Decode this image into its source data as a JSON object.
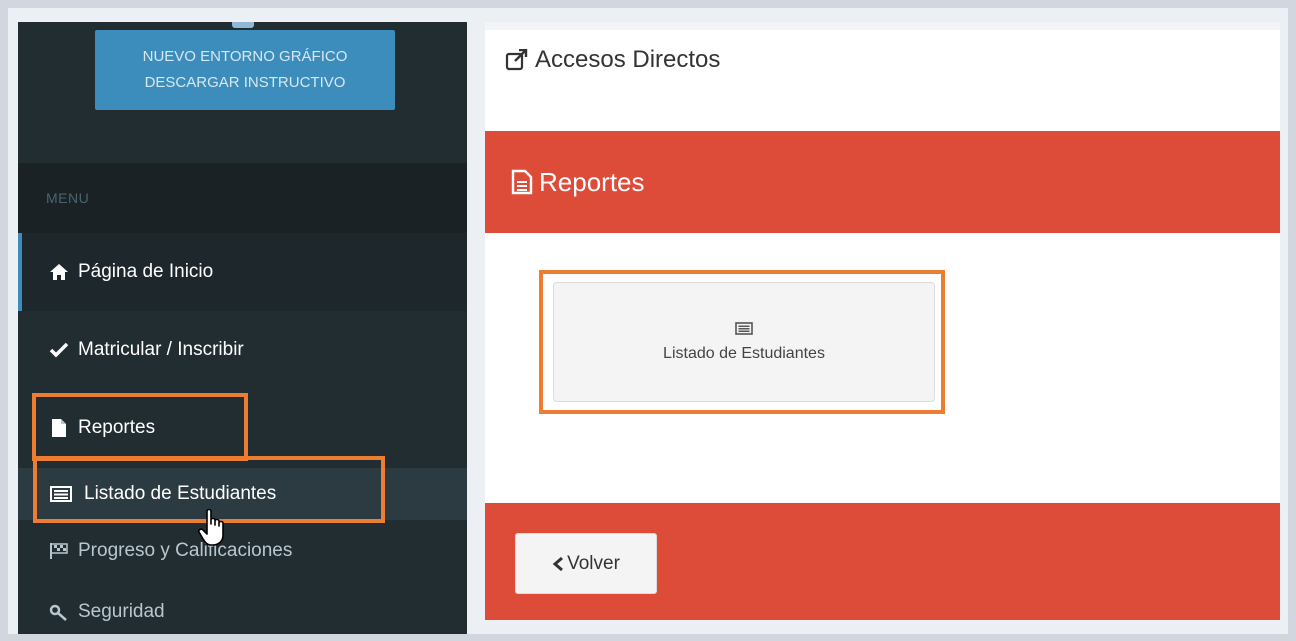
{
  "sidebar": {
    "promo_line1": "NUEVO ENTORNO GRÁFICO",
    "promo_line2": "DESCARGAR INSTRUCTIVO",
    "menu_header": "MENU",
    "items": [
      {
        "label": "Página de Inicio",
        "icon": "home-icon"
      },
      {
        "label": "Matricular / Inscribir",
        "icon": "check-icon"
      },
      {
        "label": "Reportes",
        "icon": "file-icon"
      },
      {
        "label": "Listado de Estudiantes",
        "icon": "list-icon"
      },
      {
        "label": "Progreso y Calificaciones",
        "icon": "flag-checkered-icon"
      },
      {
        "label": "Seguridad",
        "icon": "key-icon"
      }
    ]
  },
  "main": {
    "title": "Accesos Directos",
    "section_title": "Reportes",
    "tile_label": "Listado de Estudiantes",
    "back_label": "Volver"
  },
  "colors": {
    "sidebar_bg": "#222d32",
    "accent_blue": "#3c8dbc",
    "band_red": "#dd4b39",
    "highlight_orange": "#ed7d31"
  }
}
